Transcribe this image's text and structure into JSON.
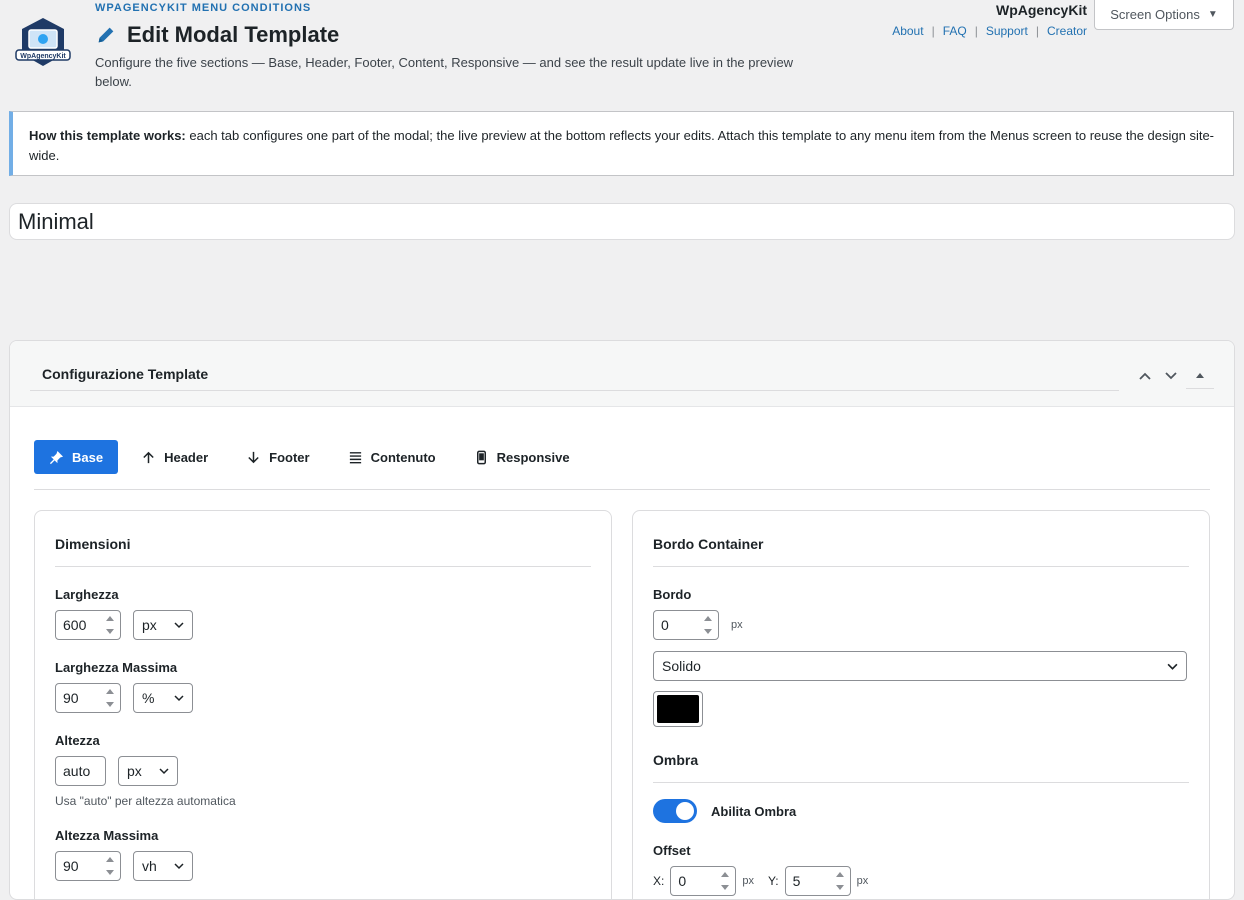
{
  "header": {
    "plugin_name": "WPAGENCYKIT MENU CONDITIONS",
    "logo_text": "WpAgencyKit",
    "page_title": "Edit Modal Template",
    "description": "Configure the five sections — Base, Header, Footer, Content, Responsive — and see the result update live in the preview below.",
    "brand": "WpAgencyKit",
    "links": [
      "About",
      "FAQ",
      "Support",
      "Creator"
    ],
    "screen_options": "Screen Options"
  },
  "notice": {
    "strong": "How this template works:",
    "text": " each tab configures one part of the modal; the live preview at the bottom reflects your edits. Attach this template to any menu item from the Menus screen to reuse the design site-wide."
  },
  "template_name": "Minimal",
  "metabox": {
    "title": "Configurazione Template",
    "tabs": [
      {
        "label": "Base",
        "icon": "pin-icon",
        "active": true
      },
      {
        "label": "Header",
        "icon": "arrow-up-icon"
      },
      {
        "label": "Footer",
        "icon": "arrow-down-icon"
      },
      {
        "label": "Contenuto",
        "icon": "list-icon"
      },
      {
        "label": "Responsive",
        "icon": "mobile-icon"
      }
    ]
  },
  "dimensions": {
    "title": "Dimensioni",
    "width_label": "Larghezza",
    "width_value": "600",
    "width_unit": "px",
    "max_width_label": "Larghezza Massima",
    "max_width_value": "90",
    "max_width_unit": "%",
    "height_label": "Altezza",
    "height_value": "auto",
    "height_unit": "px",
    "height_hint": "Usa \"auto\" per altezza automatica",
    "max_height_label": "Altezza Massima",
    "max_height_value": "90",
    "max_height_unit": "vh"
  },
  "border": {
    "title": "Bordo Container",
    "border_label": "Bordo",
    "border_value": "0",
    "border_unit": "px",
    "style_value": "Solido",
    "color": "#000000",
    "shadow_title": "Ombra",
    "shadow_toggle_label": "Abilita Ombra",
    "offset_label": "Offset",
    "x_label": "X:",
    "x_value": "0",
    "x_unit": "px",
    "y_label": "Y:",
    "y_value": "5",
    "y_unit": "px"
  },
  "colors": {
    "accent": "#1e73e0",
    "link": "#2271b1"
  }
}
